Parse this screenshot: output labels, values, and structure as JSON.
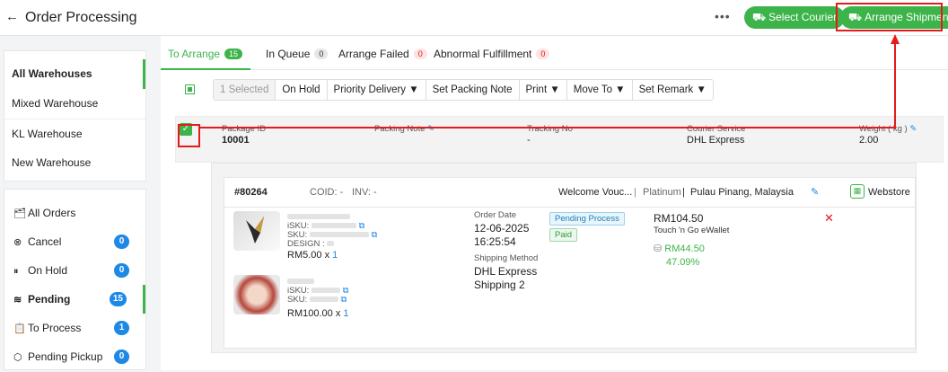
{
  "header": {
    "title": "Order Processing",
    "more": "•••",
    "select_courier": "Select Courier",
    "arrange_shipment": "Arrange Shipment"
  },
  "warehouses": [
    "All Warehouses",
    "Mixed Warehouse",
    "KL Warehouse",
    "New Warehouse"
  ],
  "orders_menu": [
    {
      "icon": "🗂",
      "label": "All Orders",
      "count": null
    },
    {
      "icon": "⊗",
      "label": "Cancel",
      "count": "0"
    },
    {
      "icon": "⏸",
      "label": "On Hold",
      "count": "0"
    },
    {
      "icon": "≋",
      "label": "Pending",
      "count": "15"
    },
    {
      "icon": "📋",
      "label": "To Process",
      "count": "1"
    },
    {
      "icon": "⬡",
      "label": "Pending Pickup",
      "count": "0"
    }
  ],
  "tabs": [
    {
      "label": "To Arrange",
      "count": "15"
    },
    {
      "label": "In Queue",
      "count": "0"
    },
    {
      "label": "Arrange Failed",
      "count": "0"
    },
    {
      "label": "Abnormal Fulfillment",
      "count": "0"
    }
  ],
  "toolbar": [
    "1 Selected",
    "On Hold",
    "Priority Delivery ▼",
    "Set Packing Note",
    "Print ▼",
    "Move To ▼",
    "Set Remark ▼"
  ],
  "package": {
    "package_id_label": "Package ID",
    "package_id": "10001",
    "packing_note_label": "Packing Note",
    "tracking_label": "Tracking No",
    "tracking": "-",
    "courier_label": "Courier Service",
    "courier": "DHL Express",
    "weight_label": "Weight ( kg )",
    "weight": "2.00"
  },
  "order": {
    "number": "#80264",
    "coid": "COID: -",
    "inv": "INV: -",
    "voucher": "Welcome Vouc...",
    "tier": "Platinum",
    "location": "Pulau Pinang, Malaysia",
    "store": "Webstore",
    "items": [
      {
        "isku": "iSKU:",
        "sku": "SKU:",
        "design": "DESIGN :",
        "price": "RM5.00",
        "qty_x": "x",
        "qty": "1"
      },
      {
        "isku": "iSKU:",
        "sku": "SKU:",
        "price": "RM100.00",
        "qty_x": "x",
        "qty": "1"
      }
    ],
    "order_date_label": "Order Date",
    "order_date": "12-06-2025",
    "order_time": "16:25:54",
    "ship_method_label": "Shipping Method",
    "ship_method": "DHL Express",
    "ship_method2": "Shipping 2",
    "status_chip": "Pending Process",
    "paid_chip": "Paid",
    "amount": "RM104.50",
    "payment": "Touch 'n Go eWallet",
    "profit": "RM44.50",
    "profit_pct": "47.09%",
    "remove": "✕"
  }
}
